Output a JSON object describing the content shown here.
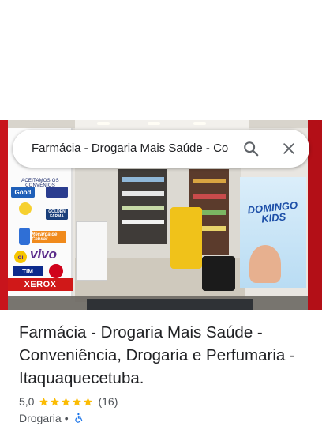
{
  "search": {
    "query": "Farmácia - Drogaria Mais Saúde - Co"
  },
  "photo": {
    "convenios_label": "ACEITAMOS OS CONVÊNIOS",
    "logo_good": "Good",
    "logo_golden": "GOLDEN FARMA",
    "logo_recarga": "Recarga de Celular",
    "logo_oi": "oi",
    "logo_vivo": "vivo",
    "logo_tim": "TIM",
    "xerox_label": "XEROX",
    "domingo_label": "DOMINGO KIDS"
  },
  "place": {
    "title": "Farmácia - Drogaria Mais Saúde - Conveniência, Drogaria e Perfumaria - Itaquaquecetuba.",
    "rating": "5,0",
    "stars": 5,
    "review_count": "(16)",
    "category": "Drogaria",
    "separator": "•"
  },
  "icons": {
    "search": "search-icon",
    "close": "close-icon",
    "star": "star-icon",
    "accessibility": "wheelchair-accessible-icon"
  },
  "colors": {
    "star": "#fbbc04",
    "accessibility": "#1a73e8",
    "title_text": "#202124",
    "secondary_text": "#4d5156"
  }
}
